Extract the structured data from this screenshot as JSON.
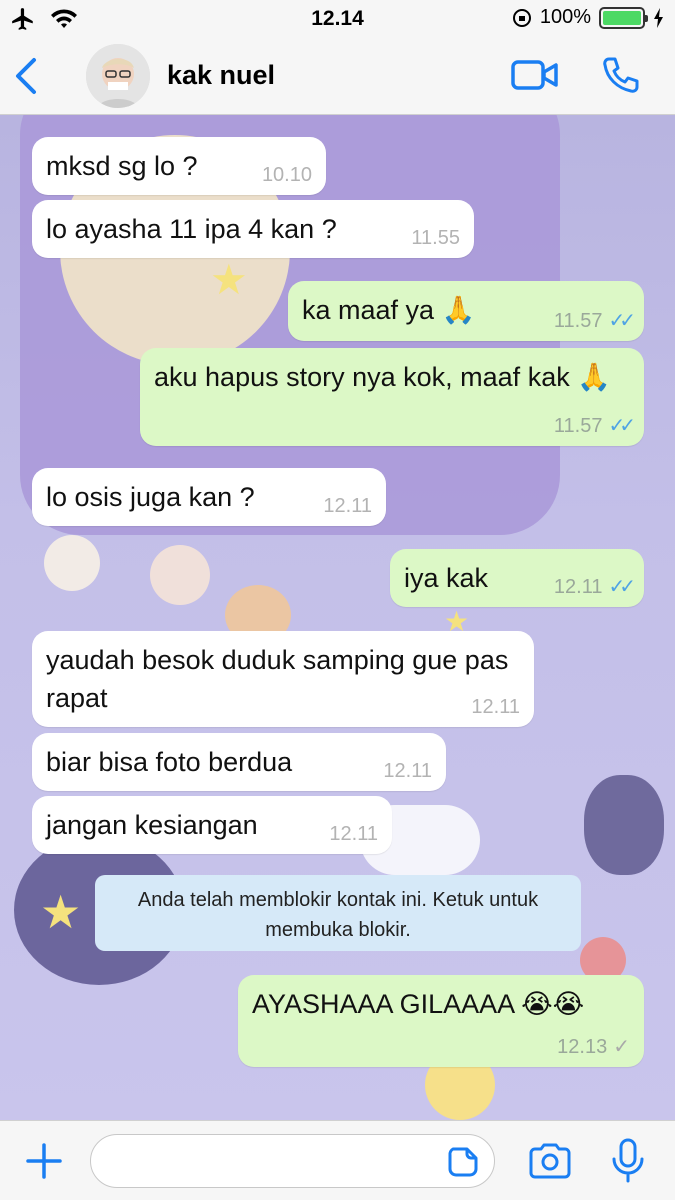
{
  "status_bar": {
    "time": "12.14",
    "battery_percent": "100%"
  },
  "header": {
    "contact_name": "kak nuel"
  },
  "messages": [
    {
      "dir": "in",
      "text": "mksd sg lo ?",
      "time": "10.10"
    },
    {
      "dir": "in",
      "text": "lo ayasha 11 ipa 4 kan ?",
      "time": "11.55"
    },
    {
      "dir": "out",
      "text": "ka maaf ya 🙏",
      "time": "11.57",
      "status": "read"
    },
    {
      "dir": "out",
      "text": "aku hapus story nya kok, maaf kak 🙏",
      "time": "11.57",
      "status": "read"
    },
    {
      "dir": "in",
      "text": "lo osis juga kan ?",
      "time": "12.11"
    },
    {
      "dir": "out",
      "text": "iya kak",
      "time": "12.11",
      "status": "read"
    },
    {
      "dir": "in",
      "text": "yaudah besok duduk samping gue pas rapat",
      "time": "12.11"
    },
    {
      "dir": "in",
      "text": "biar bisa foto berdua",
      "time": "12.11"
    },
    {
      "dir": "in",
      "text": "jangan kesiangan",
      "time": "12.11"
    },
    {
      "dir": "out",
      "text": "AYASHAAA GILAAAA 😭😭",
      "time": "12.13",
      "status": "sent"
    }
  ],
  "system_notice": "Anda telah memblokir kontak ini. Ketuk untuk membuka blokir.",
  "composer": {
    "placeholder": ""
  },
  "colors": {
    "accent": "#1a7ef2",
    "outgoing_bubble": "#dcf8c6",
    "read_tick": "#4fa3e4",
    "chat_background": "#c3bfe8"
  },
  "icons": [
    "airplane-icon",
    "wifi-icon",
    "battery-icon",
    "back-chevron-icon",
    "video-call-icon",
    "phone-icon",
    "plus-icon",
    "sticker-icon",
    "camera-icon",
    "microphone-icon"
  ]
}
